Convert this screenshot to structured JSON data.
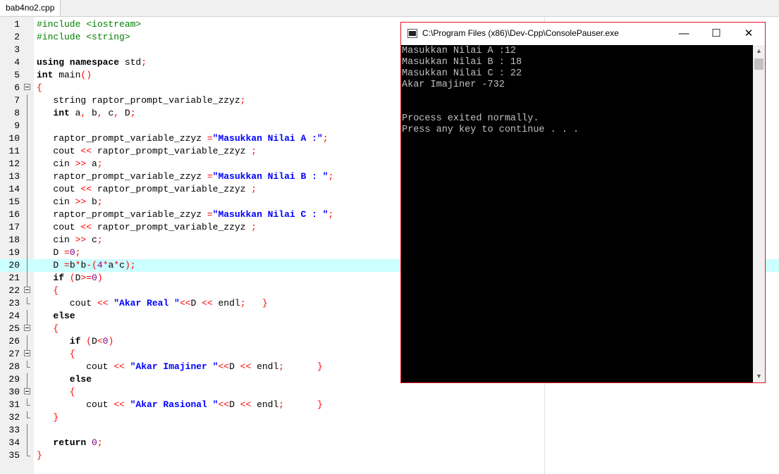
{
  "tab": {
    "label": "bab4no2.cpp"
  },
  "editor": {
    "highlighted_line": 20,
    "lines": [
      {
        "n": "1",
        "tokens": [
          [
            "pp",
            "#include <iostream>"
          ]
        ]
      },
      {
        "n": "2",
        "tokens": [
          [
            "pp",
            "#include <string>"
          ]
        ]
      },
      {
        "n": "3",
        "tokens": []
      },
      {
        "n": "4",
        "tokens": [
          [
            "kw",
            "using namespace"
          ],
          [
            "id",
            " std"
          ],
          [
            "sym",
            ";"
          ]
        ]
      },
      {
        "n": "5",
        "tokens": [
          [
            "kw",
            "int"
          ],
          [
            "id",
            " main"
          ],
          [
            "sym",
            "()"
          ]
        ]
      },
      {
        "n": "6",
        "fold": "open",
        "tokens": [
          [
            "sym",
            "{"
          ]
        ]
      },
      {
        "n": "7",
        "fold": "line",
        "tokens": [
          [
            "id",
            "   string raptor_prompt_variable_zzyz"
          ],
          [
            "sym",
            ";"
          ]
        ]
      },
      {
        "n": "8",
        "fold": "line",
        "tokens": [
          [
            "kw",
            "   int"
          ],
          [
            "id",
            " a"
          ],
          [
            "sym",
            ","
          ],
          [
            "id",
            " b"
          ],
          [
            "sym",
            ","
          ],
          [
            "id",
            " c"
          ],
          [
            "sym",
            ","
          ],
          [
            "id",
            " D"
          ],
          [
            "sym",
            ";"
          ]
        ]
      },
      {
        "n": "9",
        "fold": "line",
        "tokens": []
      },
      {
        "n": "10",
        "fold": "line",
        "tokens": [
          [
            "id",
            "   raptor_prompt_variable_zzyz "
          ],
          [
            "sym",
            "="
          ],
          [
            "str",
            "\"Masukkan Nilai A :\""
          ],
          [
            "sym",
            ";"
          ]
        ]
      },
      {
        "n": "11",
        "fold": "line",
        "tokens": [
          [
            "id",
            "   cout "
          ],
          [
            "sym",
            "<<"
          ],
          [
            "id",
            " raptor_prompt_variable_zzyz "
          ],
          [
            "sym",
            ";"
          ]
        ]
      },
      {
        "n": "12",
        "fold": "line",
        "tokens": [
          [
            "id",
            "   cin "
          ],
          [
            "sym",
            ">>"
          ],
          [
            "id",
            " a"
          ],
          [
            "sym",
            ";"
          ]
        ]
      },
      {
        "n": "13",
        "fold": "line",
        "tokens": [
          [
            "id",
            "   raptor_prompt_variable_zzyz "
          ],
          [
            "sym",
            "="
          ],
          [
            "str",
            "\"Masukkan Nilai B : \""
          ],
          [
            "sym",
            ";"
          ]
        ]
      },
      {
        "n": "14",
        "fold": "line",
        "tokens": [
          [
            "id",
            "   cout "
          ],
          [
            "sym",
            "<<"
          ],
          [
            "id",
            " raptor_prompt_variable_zzyz "
          ],
          [
            "sym",
            ";"
          ]
        ]
      },
      {
        "n": "15",
        "fold": "line",
        "tokens": [
          [
            "id",
            "   cin "
          ],
          [
            "sym",
            ">>"
          ],
          [
            "id",
            " b"
          ],
          [
            "sym",
            ";"
          ]
        ]
      },
      {
        "n": "16",
        "fold": "line",
        "tokens": [
          [
            "id",
            "   raptor_prompt_variable_zzyz "
          ],
          [
            "sym",
            "="
          ],
          [
            "str",
            "\"Masukkan Nilai C : \""
          ],
          [
            "sym",
            ";"
          ]
        ]
      },
      {
        "n": "17",
        "fold": "line",
        "tokens": [
          [
            "id",
            "   cout "
          ],
          [
            "sym",
            "<<"
          ],
          [
            "id",
            " raptor_prompt_variable_zzyz "
          ],
          [
            "sym",
            ";"
          ]
        ]
      },
      {
        "n": "18",
        "fold": "line",
        "tokens": [
          [
            "id",
            "   cin "
          ],
          [
            "sym",
            ">>"
          ],
          [
            "id",
            " c"
          ],
          [
            "sym",
            ";"
          ]
        ]
      },
      {
        "n": "19",
        "fold": "line",
        "tokens": [
          [
            "id",
            "   D "
          ],
          [
            "sym",
            "="
          ],
          [
            "num",
            "0"
          ],
          [
            "sym",
            ";"
          ]
        ]
      },
      {
        "n": "20",
        "fold": "line",
        "tokens": [
          [
            "id",
            "   D "
          ],
          [
            "sym",
            "="
          ],
          [
            "id",
            "b"
          ],
          [
            "sym",
            "*"
          ],
          [
            "id",
            "b"
          ],
          [
            "sym",
            "-("
          ],
          [
            "num",
            "4"
          ],
          [
            "sym",
            "*"
          ],
          [
            "id",
            "a"
          ],
          [
            "sym",
            "*"
          ],
          [
            "id",
            "c"
          ],
          [
            "sym",
            ");"
          ]
        ]
      },
      {
        "n": "21",
        "fold": "line",
        "tokens": [
          [
            "kw",
            "   if"
          ],
          [
            "sym",
            " ("
          ],
          [
            "id",
            "D"
          ],
          [
            "sym",
            ">="
          ],
          [
            "num",
            "0"
          ],
          [
            "sym",
            ")"
          ]
        ]
      },
      {
        "n": "22",
        "fold": "open",
        "tokens": [
          [
            "sym",
            "   {"
          ]
        ]
      },
      {
        "n": "23",
        "fold": "end",
        "tokens": [
          [
            "id",
            "      cout "
          ],
          [
            "sym",
            "<<"
          ],
          [
            "str",
            " \"Akar Real \""
          ],
          [
            "sym",
            "<<"
          ],
          [
            "id",
            "D "
          ],
          [
            "sym",
            "<<"
          ],
          [
            "id",
            " endl"
          ],
          [
            "sym",
            ";"
          ],
          [
            "id",
            "   "
          ],
          [
            "sym",
            "}"
          ]
        ]
      },
      {
        "n": "24",
        "fold": "line",
        "tokens": [
          [
            "kw",
            "   else"
          ]
        ]
      },
      {
        "n": "25",
        "fold": "open",
        "tokens": [
          [
            "sym",
            "   {"
          ]
        ]
      },
      {
        "n": "26",
        "fold": "line",
        "tokens": [
          [
            "kw",
            "      if"
          ],
          [
            "sym",
            " ("
          ],
          [
            "id",
            "D"
          ],
          [
            "sym",
            "<"
          ],
          [
            "num",
            "0"
          ],
          [
            "sym",
            ")"
          ]
        ]
      },
      {
        "n": "27",
        "fold": "open",
        "tokens": [
          [
            "sym",
            "      {"
          ]
        ]
      },
      {
        "n": "28",
        "fold": "end",
        "tokens": [
          [
            "id",
            "         cout "
          ],
          [
            "sym",
            "<<"
          ],
          [
            "str",
            " \"Akar Imajiner \""
          ],
          [
            "sym",
            "<<"
          ],
          [
            "id",
            "D "
          ],
          [
            "sym",
            "<<"
          ],
          [
            "id",
            " endl"
          ],
          [
            "sym",
            ";"
          ],
          [
            "id",
            "      "
          ],
          [
            "sym",
            "}"
          ]
        ]
      },
      {
        "n": "29",
        "fold": "line",
        "tokens": [
          [
            "kw",
            "      else"
          ]
        ]
      },
      {
        "n": "30",
        "fold": "open",
        "tokens": [
          [
            "sym",
            "      {"
          ]
        ]
      },
      {
        "n": "31",
        "fold": "end",
        "tokens": [
          [
            "id",
            "         cout "
          ],
          [
            "sym",
            "<<"
          ],
          [
            "str",
            " \"Akar Rasional \""
          ],
          [
            "sym",
            "<<"
          ],
          [
            "id",
            "D "
          ],
          [
            "sym",
            "<<"
          ],
          [
            "id",
            " endl"
          ],
          [
            "sym",
            ";"
          ],
          [
            "id",
            "      "
          ],
          [
            "sym",
            "}"
          ]
        ]
      },
      {
        "n": "32",
        "fold": "end",
        "tokens": [
          [
            "sym",
            "   }"
          ]
        ]
      },
      {
        "n": "33",
        "fold": "line",
        "tokens": []
      },
      {
        "n": "34",
        "fold": "line",
        "tokens": [
          [
            "kw",
            "   return"
          ],
          [
            "num",
            " 0"
          ],
          [
            "sym",
            ";"
          ]
        ]
      },
      {
        "n": "35",
        "fold": "end",
        "tokens": [
          [
            "sym",
            "}"
          ]
        ]
      }
    ]
  },
  "console": {
    "title": "C:\\Program Files (x86)\\Dev-Cpp\\ConsolePauser.exe",
    "minimize": "—",
    "maximize": "☐",
    "close": "✕",
    "output": [
      "Masukkan Nilai A :12",
      "Masukkan Nilai B : 18",
      "Masukkan Nilai C : 22",
      "Akar Imajiner -732",
      "",
      "",
      "Process exited normally.",
      "Press any key to continue . . ."
    ],
    "scroll_up": "▲",
    "scroll_down": "▼"
  }
}
